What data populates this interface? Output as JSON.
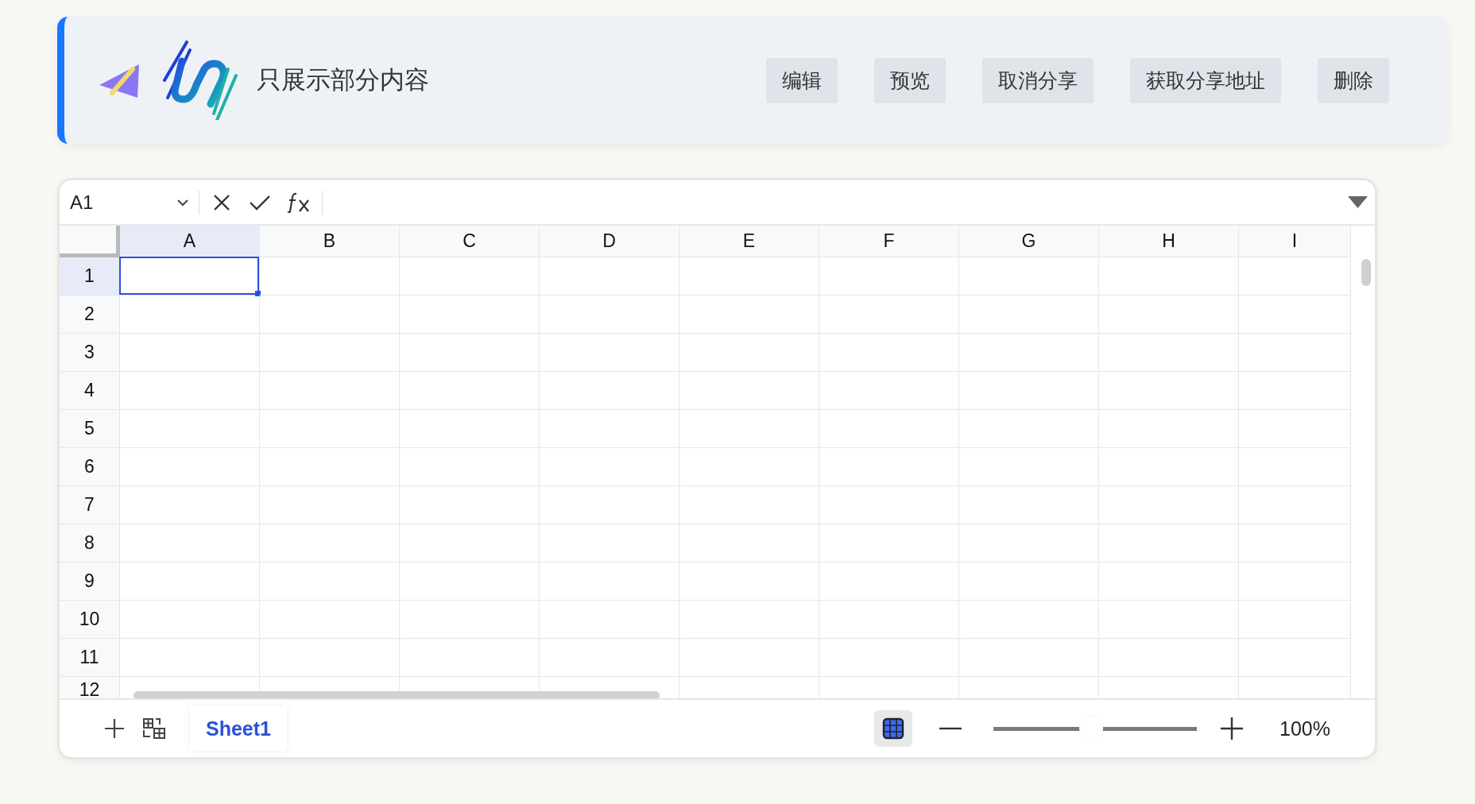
{
  "header": {
    "title": "只展示部分内容",
    "buttons": [
      "编辑",
      "预览",
      "取消分享",
      "获取分享地址",
      "删除"
    ]
  },
  "formula_bar": {
    "cell_ref": "A1"
  },
  "sheet": {
    "columns": [
      {
        "label": "A",
        "selected": true
      },
      {
        "label": "B",
        "selected": false
      },
      {
        "label": "C",
        "selected": false
      },
      {
        "label": "D",
        "selected": false
      },
      {
        "label": "E",
        "selected": false
      },
      {
        "label": "F",
        "selected": false
      },
      {
        "label": "G",
        "selected": false
      },
      {
        "label": "H",
        "selected": false
      },
      {
        "label": "I",
        "selected": false
      }
    ],
    "rows": [
      {
        "label": "1",
        "selected": true
      },
      {
        "label": "2",
        "selected": false
      },
      {
        "label": "3",
        "selected": false
      },
      {
        "label": "4",
        "selected": false
      },
      {
        "label": "5",
        "selected": false
      },
      {
        "label": "6",
        "selected": false
      },
      {
        "label": "7",
        "selected": false
      },
      {
        "label": "8",
        "selected": false
      },
      {
        "label": "9",
        "selected": false
      },
      {
        "label": "10",
        "selected": false
      },
      {
        "label": "11",
        "selected": false
      },
      {
        "label": "12",
        "selected": false
      }
    ]
  },
  "sheet_tabs": [
    {
      "label": "Sheet1",
      "selected": true
    }
  ],
  "status_bar": {
    "gridlines_on": true,
    "zoom": {
      "level": 0.48,
      "reading": "100%"
    }
  }
}
